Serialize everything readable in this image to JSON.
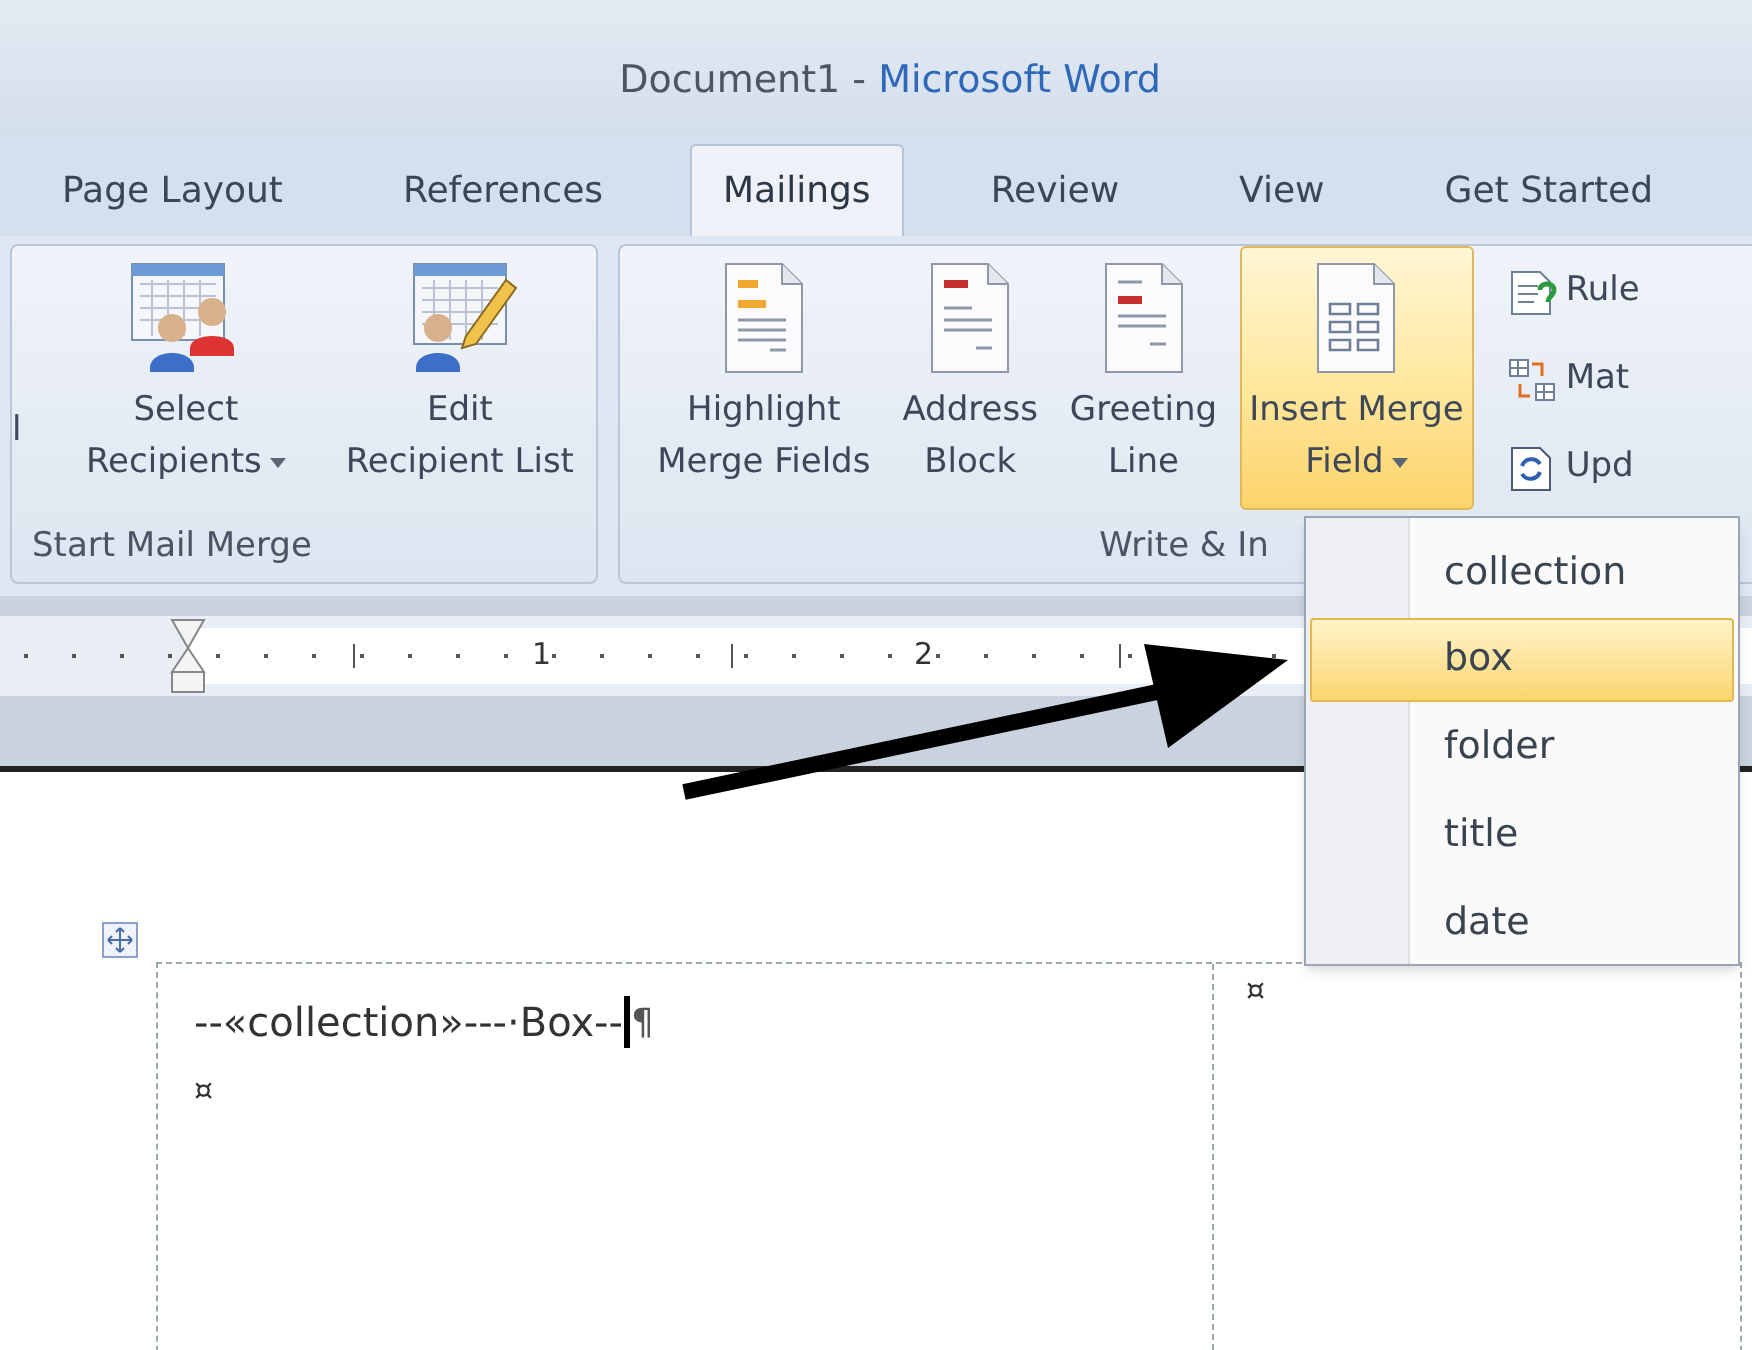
{
  "window": {
    "document": "Document1",
    "separator": "-",
    "app": "Microsoft Word"
  },
  "tabs": [
    {
      "label": "Page Layout",
      "selected": false
    },
    {
      "label": "References",
      "selected": false
    },
    {
      "label": "Mailings",
      "selected": true
    },
    {
      "label": "Review",
      "selected": false
    },
    {
      "label": "View",
      "selected": false
    },
    {
      "label": "Get Started",
      "selected": false
    }
  ],
  "ribbon": {
    "groups": [
      {
        "label": "Start Mail Merge",
        "buttons": [
          {
            "kind": "fragment",
            "lines": [
              "l"
            ]
          },
          {
            "kind": "large",
            "lines": [
              "Select",
              "Recipients"
            ],
            "dropdown": true,
            "highlighted": false
          },
          {
            "kind": "large",
            "lines": [
              "Edit",
              "Recipient List"
            ],
            "dropdown": false,
            "highlighted": false
          }
        ]
      },
      {
        "label": "Write & In",
        "buttons": [
          {
            "kind": "large",
            "lines": [
              "Highlight",
              "Merge Fields"
            ],
            "dropdown": false,
            "highlighted": false
          },
          {
            "kind": "large",
            "lines": [
              "Address",
              "Block"
            ],
            "dropdown": false,
            "highlighted": false
          },
          {
            "kind": "large",
            "lines": [
              "Greeting",
              "Line"
            ],
            "dropdown": false,
            "highlighted": false
          },
          {
            "kind": "large",
            "lines": [
              "Insert Merge",
              "Field"
            ],
            "dropdown": true,
            "highlighted": true
          },
          {
            "kind": "small",
            "lines": [
              "Rule"
            ]
          },
          {
            "kind": "small",
            "lines": [
              "Mat"
            ]
          },
          {
            "kind": "small",
            "lines": [
              "Upd"
            ]
          }
        ]
      }
    ]
  },
  "ruler": {
    "marks": [
      "1",
      "2"
    ]
  },
  "menu": {
    "items": [
      {
        "label": "collection",
        "selected": false
      },
      {
        "label": "box",
        "selected": true
      },
      {
        "label": "folder",
        "selected": false
      },
      {
        "label": "title",
        "selected": false
      },
      {
        "label": "date",
        "selected": false
      }
    ]
  },
  "document": {
    "table": {
      "cells": [
        {
          "lines": [
            "--«collection»---·Box--",
            "¤"
          ],
          "pilcrow": "¶",
          "cursor": true
        },
        {
          "lines": [
            "¤"
          ],
          "cursor": false
        }
      ]
    }
  }
}
